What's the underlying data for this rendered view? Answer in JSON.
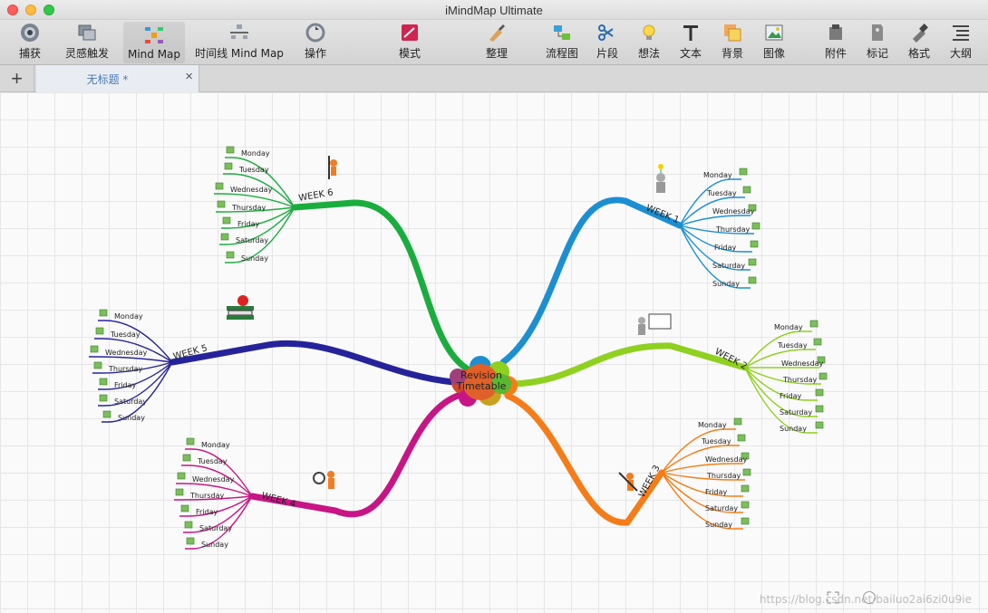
{
  "window": {
    "title": "iMindMap Ultimate"
  },
  "toolbar": {
    "items": [
      {
        "label": "捕获",
        "icon": "capture-icon"
      },
      {
        "label": "灵感触发",
        "icon": "brainstorm-icon"
      },
      {
        "label": "Mind Map",
        "icon": "mind-map-icon"
      },
      {
        "label": "时间线 Mind Map",
        "icon": "timeline-icon"
      },
      {
        "label": "操作",
        "icon": "action-icon"
      },
      {
        "label": "模式",
        "icon": "mode-icon"
      },
      {
        "label": "整理",
        "icon": "tidy-icon"
      },
      {
        "label": "流程图",
        "icon": "flowchart-icon"
      },
      {
        "label": "片段",
        "icon": "snippet-icon"
      },
      {
        "label": "想法",
        "icon": "idea-icon"
      },
      {
        "label": "文本",
        "icon": "text-icon"
      },
      {
        "label": "背景",
        "icon": "background-icon"
      },
      {
        "label": "图像",
        "icon": "image-icon"
      },
      {
        "label": "附件",
        "icon": "attachment-icon"
      },
      {
        "label": "标记",
        "icon": "marker-icon"
      },
      {
        "label": "格式",
        "icon": "format-icon"
      },
      {
        "label": "大纲",
        "icon": "outline-icon"
      }
    ]
  },
  "tabs": {
    "add_label": "+",
    "active_title": "无标题 *",
    "close_label": "×"
  },
  "mindmap": {
    "central": {
      "line1": "Revision",
      "line2": "Timetable"
    },
    "branches": [
      {
        "label": "WEEK 1",
        "color": "#1b8fd2",
        "days": [
          "Monday",
          "Tuesday",
          "Wednesday",
          "Thursday",
          "Friday",
          "Saturday",
          "Sunday"
        ]
      },
      {
        "label": "WEEK 2",
        "color": "#8fd020",
        "days": [
          "Monday",
          "Tuesday",
          "Wednesday",
          "Thursday",
          "Friday",
          "Saturday",
          "Sunday"
        ]
      },
      {
        "label": "WEEK 3",
        "color": "#f57c18",
        "days": [
          "Monday",
          "Tuesday",
          "Wednesday",
          "Thursday",
          "Friday",
          "Saturday",
          "Sunday"
        ]
      },
      {
        "label": "WEEK 4",
        "color": "#c71585",
        "days": [
          "Monday",
          "Tuesday",
          "Wednesday",
          "Thursday",
          "Friday",
          "Saturday",
          "Sunday"
        ]
      },
      {
        "label": "WEEK 5",
        "color": "#26239a",
        "days": [
          "Monday",
          "Tuesday",
          "Wednesday",
          "Thursday",
          "Friday",
          "Saturday",
          "Sunday"
        ]
      },
      {
        "label": "WEEK 6",
        "color": "#1aad3e",
        "days": [
          "Monday",
          "Tuesday",
          "Wednesday",
          "Thursday",
          "Friday",
          "Saturday",
          "Sunday"
        ]
      }
    ]
  },
  "footer": {
    "watermark": "https://blog.csdn.net/bailuo2ai6zi0u9ie"
  }
}
